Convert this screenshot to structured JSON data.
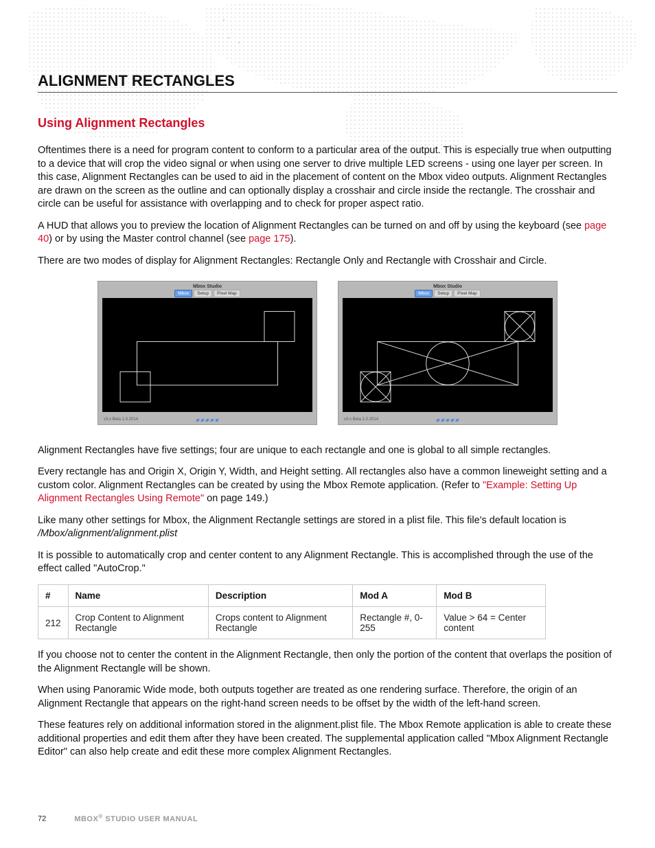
{
  "heading": "ALIGNMENT RECTANGLES",
  "subheading": "Using Alignment Rectangles",
  "para1": "Oftentimes there is a need for program content to conform to a particular area of the output. This is especially true when outputting to a device that will crop the video signal or when using one server to drive multiple LED screens - using one layer per screen. In this case, Alignment Rectangles can be used to aid in the placement of content on the Mbox video outputs. Alignment Rectangles are drawn on the screen as the outline and can optionally display a crosshair and circle inside the rectangle. The crosshair and circle can be useful for assistance with overlapping and to check for proper aspect ratio.",
  "para2_a": "A HUD that allows you to preview the location of Alignment Rectangles can be turned on and off by using the keyboard (see ",
  "para2_link1": "page 40",
  "para2_b": ") or by using the Master control channel (see ",
  "para2_link2": "page 175",
  "para2_c": ").",
  "para3": "There are two modes of display for Alignment Rectangles: Rectangle Only and Rectangle with Crosshair and Circle.",
  "fig_title": "Mbox Studio",
  "fig_tab1": "Mbox",
  "fig_tab2": "Setup",
  "fig_tab3": "Pixel Map",
  "fig_footer": "v3.x Beta 1.0.2014",
  "para4": "Alignment Rectangles have five settings; four are unique to each rectangle and one is global to all simple rectangles.",
  "para5_a": "Every rectangle has and Origin X, Origin Y, Width, and Height setting. All rectangles also have a common lineweight setting and a custom color. Alignment Rectangles can be created by using the Mbox Remote application. (Refer to ",
  "para5_link": "\"Example: Setting Up Alignment Rectangles Using Remote\"",
  "para5_b": " on page 149.)",
  "para6_a": "Like many other settings for Mbox, the Alignment Rectangle settings are stored in a plist file. This file's default location is ",
  "para6_path": "/Mbox/alignment/alignment.plist",
  "para7": "It is possible to automatically crop and center content to any Alignment Rectangle. This is accomplished through the use of the effect called \"AutoCrop.\"",
  "table": {
    "headers": [
      "#",
      "Name",
      "Description",
      "Mod A",
      "Mod B"
    ],
    "row": [
      "212",
      "Crop Content to Alignment Rectangle",
      "Crops content to Alignment Rectangle",
      "Rectangle #, 0-255",
      "Value > 64 = Center content"
    ]
  },
  "para8": "If you choose not to center the content in the Alignment Rectangle, then only the portion of the content that overlaps the position of the Alignment Rectangle will be shown.",
  "para9": "When using Panoramic Wide mode, both outputs together are treated as one rendering surface. Therefore, the origin of an Alignment Rectangle that appears on the right-hand screen needs to be offset by the width of the left-hand screen.",
  "para10": "These features rely on additional information stored in the alignment.plist file. The Mbox Remote application is able to create these additional properties and edit them after they have been created. The supplemental application called \"Mbox Alignment Rectangle Editor\" can also help create and edit these more complex Alignment Rectangles.",
  "page_number": "72",
  "manual_title": "MBOX® STUDIO USER MANUAL"
}
